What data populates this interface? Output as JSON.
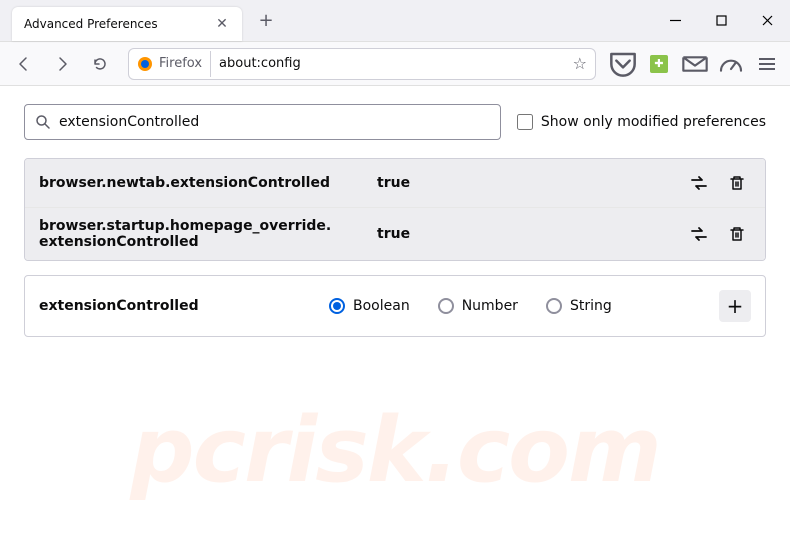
{
  "window": {
    "tab_title": "Advanced Preferences"
  },
  "urlbar": {
    "identity_label": "Firefox",
    "url": "about:config"
  },
  "search": {
    "value": "extensionControlled",
    "checkbox_label": "Show only modified preferences"
  },
  "prefs": [
    {
      "name": "browser.newtab.extensionControlled",
      "value": "true"
    },
    {
      "name": "browser.startup.homepage_override.\nextensionControlled",
      "value": "true"
    }
  ],
  "new_pref": {
    "name": "extensionControlled",
    "types": [
      "Boolean",
      "Number",
      "String"
    ],
    "selected_index": 0
  },
  "watermark": "pcrisk.com"
}
